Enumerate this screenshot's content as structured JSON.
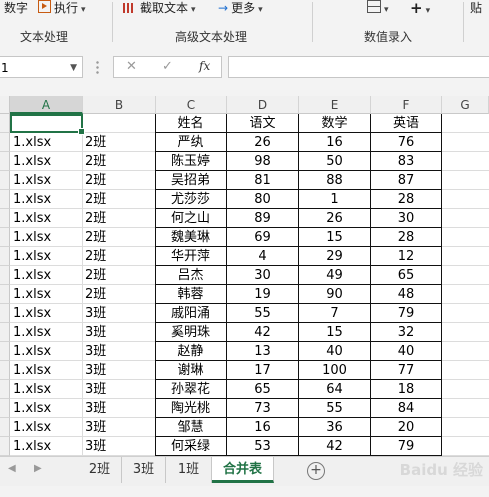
{
  "ribbon": {
    "items": [
      {
        "id": "shuzi",
        "label": "数字"
      },
      {
        "id": "exec",
        "label": "执行"
      },
      {
        "id": "cut",
        "label": "截取文本"
      },
      {
        "id": "more",
        "label": "更多"
      },
      {
        "id": "paste",
        "label": "贴"
      }
    ],
    "groups": [
      "文本处理",
      "高级文本处理",
      "数值录入"
    ]
  },
  "formula_bar": {
    "name_box": "1",
    "cancel": "✕",
    "enter": "✓",
    "fx": "fx",
    "value": ""
  },
  "columns": [
    "A",
    "B",
    "C",
    "D",
    "E",
    "F",
    "G"
  ],
  "header_row": {
    "name": "姓名",
    "chinese": "语文",
    "math": "数学",
    "english": "英语"
  },
  "rows": [
    {
      "file": "1.xlsx",
      "cls": "2班",
      "name": "严纨",
      "chinese": "26",
      "math": "16",
      "english": "76"
    },
    {
      "file": "1.xlsx",
      "cls": "2班",
      "name": "陈玉婷",
      "chinese": "98",
      "math": "50",
      "english": "83"
    },
    {
      "file": "1.xlsx",
      "cls": "2班",
      "name": "吴招弟",
      "chinese": "81",
      "math": "88",
      "english": "87"
    },
    {
      "file": "1.xlsx",
      "cls": "2班",
      "name": "尤莎莎",
      "chinese": "80",
      "math": "1",
      "english": "28"
    },
    {
      "file": "1.xlsx",
      "cls": "2班",
      "name": "何之山",
      "chinese": "89",
      "math": "26",
      "english": "30"
    },
    {
      "file": "1.xlsx",
      "cls": "2班",
      "name": "魏美琳",
      "chinese": "69",
      "math": "15",
      "english": "28"
    },
    {
      "file": "1.xlsx",
      "cls": "2班",
      "name": "华开萍",
      "chinese": "4",
      "math": "29",
      "english": "12"
    },
    {
      "file": "1.xlsx",
      "cls": "2班",
      "name": "吕杰",
      "chinese": "30",
      "math": "49",
      "english": "65"
    },
    {
      "file": "1.xlsx",
      "cls": "2班",
      "name": "韩蓉",
      "chinese": "19",
      "math": "90",
      "english": "48"
    },
    {
      "file": "1.xlsx",
      "cls": "3班",
      "name": "戚阳涌",
      "chinese": "55",
      "math": "7",
      "english": "79"
    },
    {
      "file": "1.xlsx",
      "cls": "3班",
      "name": "奚明珠",
      "chinese": "42",
      "math": "15",
      "english": "32"
    },
    {
      "file": "1.xlsx",
      "cls": "3班",
      "name": "赵静",
      "chinese": "13",
      "math": "40",
      "english": "40"
    },
    {
      "file": "1.xlsx",
      "cls": "3班",
      "name": "谢琳",
      "chinese": "17",
      "math": "100",
      "english": "77"
    },
    {
      "file": "1.xlsx",
      "cls": "3班",
      "name": "孙翠花",
      "chinese": "65",
      "math": "64",
      "english": "18"
    },
    {
      "file": "1.xlsx",
      "cls": "3班",
      "name": "陶光桃",
      "chinese": "73",
      "math": "55",
      "english": "84"
    },
    {
      "file": "1.xlsx",
      "cls": "3班",
      "name": "邹慧",
      "chinese": "16",
      "math": "36",
      "english": "20"
    },
    {
      "file": "1.xlsx",
      "cls": "3班",
      "name": "何采绿",
      "chinese": "53",
      "math": "42",
      "english": "79"
    }
  ],
  "sheet_tabs": [
    {
      "label": "2班",
      "active": false
    },
    {
      "label": "3班",
      "active": false
    },
    {
      "label": "1班",
      "active": false
    },
    {
      "label": "合并表",
      "active": true
    }
  ],
  "watermark": "Baidu 经验",
  "colors": {
    "accent": "#217346",
    "border": "#111111"
  }
}
